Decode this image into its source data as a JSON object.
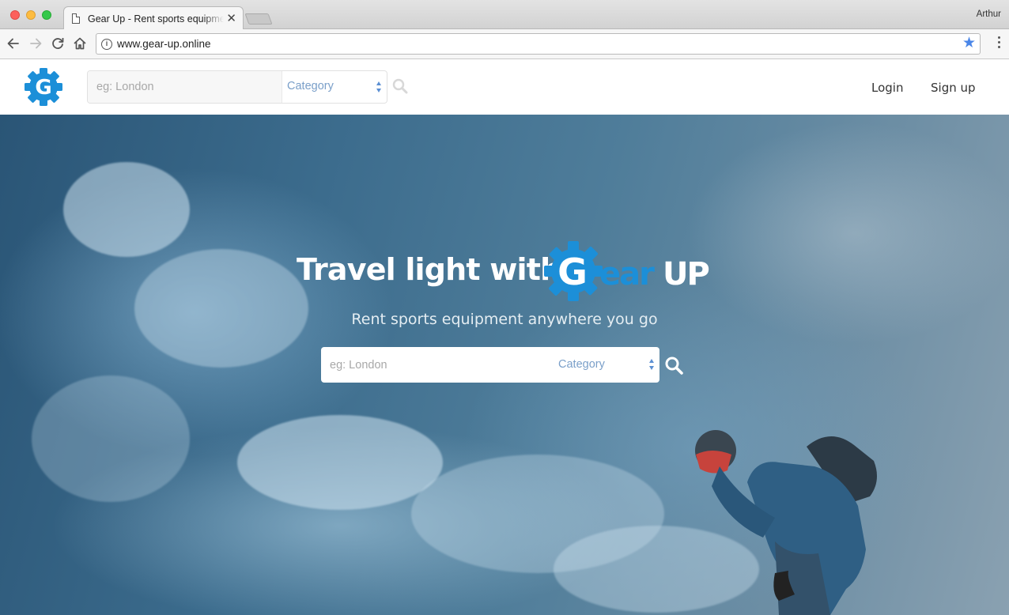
{
  "browser": {
    "tab_title": "Gear Up - Rent sports equipment anywhere you go",
    "url": "www.gear-up.online",
    "profile_name": "Arthur",
    "bookmark_star_color": "#4a86e8"
  },
  "header": {
    "logo_letter": "G",
    "search": {
      "location_placeholder": "eg: London",
      "category_label": "Category"
    },
    "nav": {
      "login_label": "Login",
      "signup_label": "Sign up"
    }
  },
  "hero": {
    "title_lead": "Travel light with",
    "brand": {
      "g": "G",
      "ear": "ear",
      "up": "UP"
    },
    "subtitle": "Rent sports equipment anywhere you go",
    "search": {
      "location_placeholder": "eg: London",
      "category_label": "Category"
    }
  },
  "colors": {
    "brand_blue": "#1c8fd8",
    "category_text": "#7a9fc9"
  }
}
